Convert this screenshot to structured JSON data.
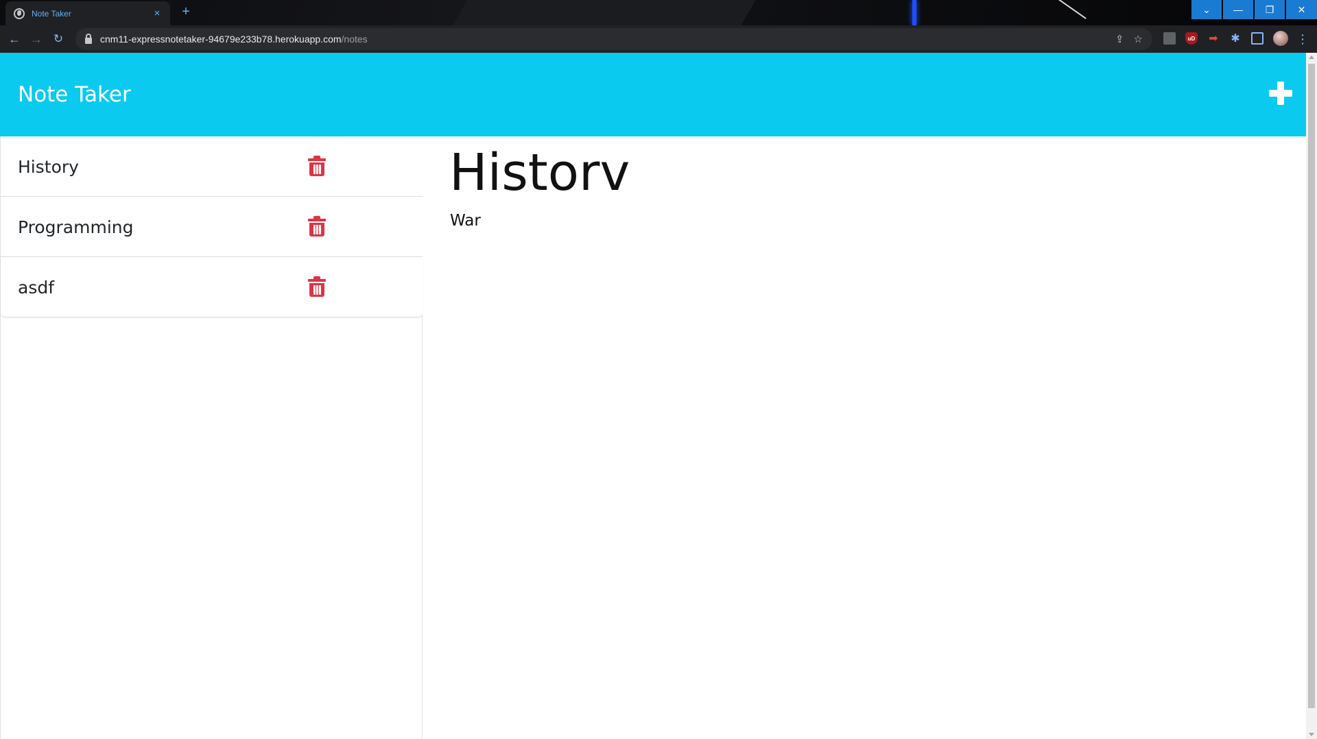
{
  "browser": {
    "tab": {
      "title": "Note Taker",
      "close_glyph": "×",
      "favicon": "globe-icon"
    },
    "new_tab_glyph": "+",
    "url": {
      "host": "cnm11-expressnotetaker-94679e233b78.herokuapp.com",
      "path": "/notes"
    },
    "nav": {
      "back_glyph": "←",
      "forward_glyph": "→",
      "reload_glyph": "↻"
    },
    "window_controls": {
      "dropdown": "⌄",
      "minimize": "—",
      "maximize": "❐",
      "close": "✕"
    },
    "omnibox_icons": {
      "share": "⇪",
      "bookmark": "☆"
    },
    "extensions": {
      "ext2_label": "uD",
      "ext3_glyph": "➡",
      "ext4_glyph": "✱"
    },
    "menu_glyph": "⋮"
  },
  "app": {
    "title": "Note Taker",
    "accent_color": "#0acbef",
    "delete_color": "#dc3545"
  },
  "notes": [
    {
      "title": "History"
    },
    {
      "title": "Programming"
    },
    {
      "title": "asdf"
    }
  ],
  "active_note": {
    "title": "Historv",
    "text": "War"
  }
}
